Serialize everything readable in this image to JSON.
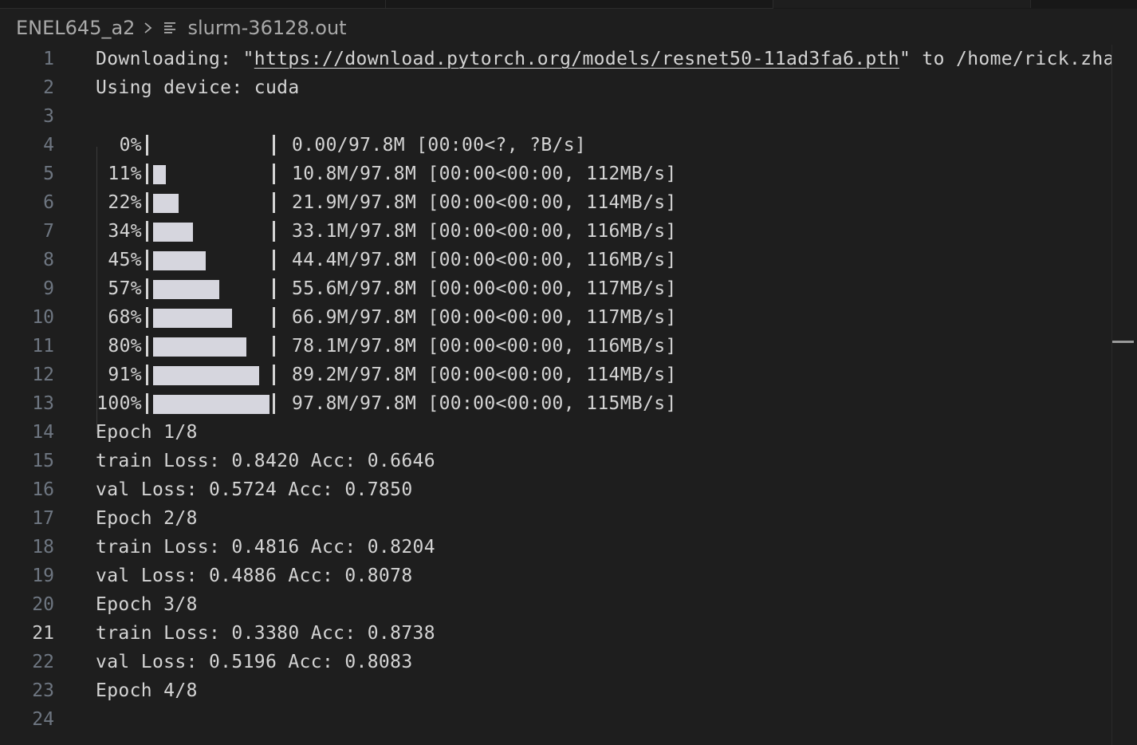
{
  "breadcrumb": {
    "folder": "ENEL645_a2",
    "file": "slurm-36128.out"
  },
  "editor": {
    "current_line": 21,
    "lines": [
      {
        "n": "1",
        "text": "Downloading: \"",
        "url": "https://download.pytorch.org/models/resnet50-11ad3fa6.pth",
        "after": "\" to /home/rick.zha"
      },
      {
        "n": "2",
        "text": "Using device: cuda"
      },
      {
        "n": "3",
        "text": ""
      },
      {
        "n": "4",
        "percent": "0%",
        "progress": 0.0,
        "stats": "0.00/97.8M [00:00<?, ?B/s]"
      },
      {
        "n": "5",
        "percent": "11%",
        "progress": 0.11,
        "stats": "10.8M/97.8M [00:00<00:00, 112MB/s]"
      },
      {
        "n": "6",
        "percent": "22%",
        "progress": 0.22,
        "stats": "21.9M/97.8M [00:00<00:00, 114MB/s]"
      },
      {
        "n": "7",
        "percent": "34%",
        "progress": 0.34,
        "stats": "33.1M/97.8M [00:00<00:00, 116MB/s]"
      },
      {
        "n": "8",
        "percent": "45%",
        "progress": 0.45,
        "stats": "44.4M/97.8M [00:00<00:00, 116MB/s]"
      },
      {
        "n": "9",
        "percent": "57%",
        "progress": 0.57,
        "stats": "55.6M/97.8M [00:00<00:00, 117MB/s]"
      },
      {
        "n": "10",
        "percent": "68%",
        "progress": 0.68,
        "stats": "66.9M/97.8M [00:00<00:00, 117MB/s]"
      },
      {
        "n": "11",
        "percent": "80%",
        "progress": 0.8,
        "stats": "78.1M/97.8M [00:00<00:00, 116MB/s]"
      },
      {
        "n": "12",
        "percent": "91%",
        "progress": 0.91,
        "stats": "89.2M/97.8M [00:00<00:00, 114MB/s]"
      },
      {
        "n": "13",
        "percent": "100%",
        "progress": 1.0,
        "stats": "97.8M/97.8M [00:00<00:00, 115MB/s]"
      },
      {
        "n": "14",
        "text": "Epoch 1/8"
      },
      {
        "n": "15",
        "text": "train Loss: 0.8420 Acc: 0.6646"
      },
      {
        "n": "16",
        "text": "val Loss: 0.5724 Acc: 0.7850"
      },
      {
        "n": "17",
        "text": "Epoch 2/8"
      },
      {
        "n": "18",
        "text": "train Loss: 0.4816 Acc: 0.8204"
      },
      {
        "n": "19",
        "text": "val Loss: 0.4886 Acc: 0.8078"
      },
      {
        "n": "20",
        "text": "Epoch 3/8"
      },
      {
        "n": "21",
        "text": "train Loss: 0.3380 Acc: 0.8738"
      },
      {
        "n": "22",
        "text": "val Loss: 0.5196 Acc: 0.8083"
      },
      {
        "n": "23",
        "text": "Epoch 4/8"
      },
      {
        "n": "24",
        "text": ""
      }
    ]
  },
  "icons": {
    "separator": "chevron-right-icon",
    "file": "file-lines-icon"
  },
  "colors": {
    "background": "#1e1e1e",
    "text": "#d4d4d4",
    "line_number": "#6e7681",
    "progress_fill": "#d6d6de"
  }
}
